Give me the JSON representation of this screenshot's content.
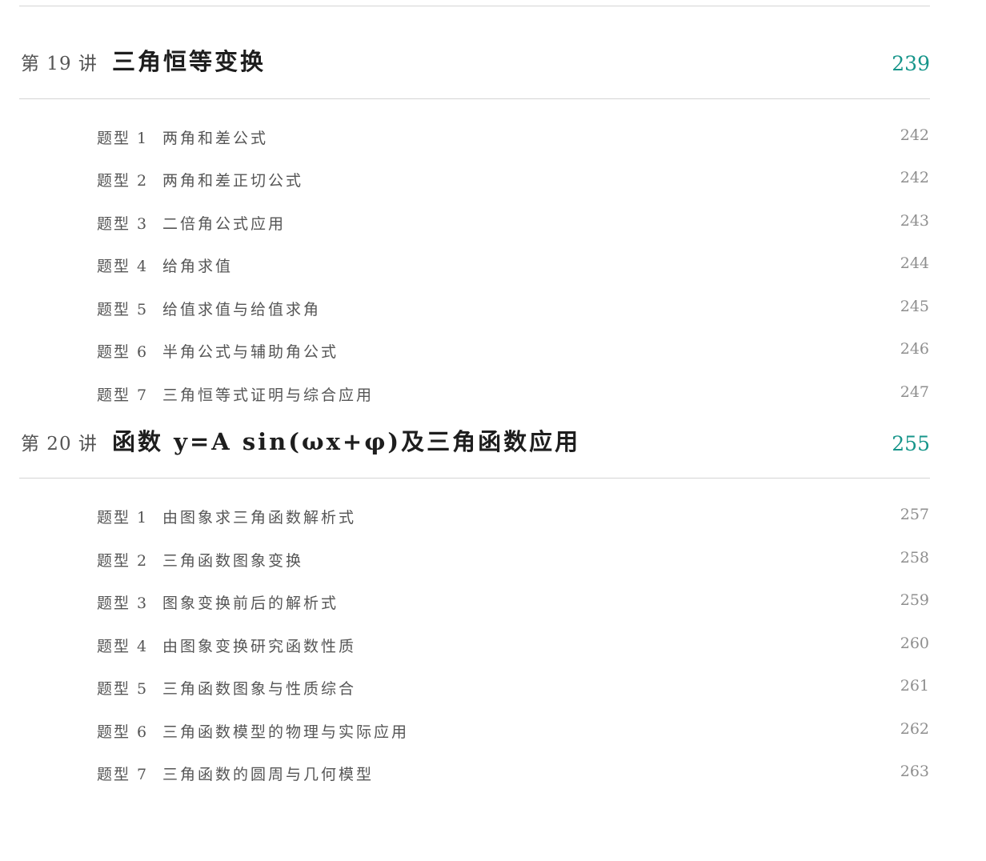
{
  "chapters": [
    {
      "prefix": "第 19 讲",
      "title": "三角恒等变换",
      "page": "239",
      "items": [
        {
          "prefix": "题型 1",
          "title": "两角和差公式",
          "page": "242"
        },
        {
          "prefix": "题型 2",
          "title": "两角和差正切公式",
          "page": "242"
        },
        {
          "prefix": "题型 3",
          "title": "二倍角公式应用",
          "page": "243"
        },
        {
          "prefix": "题型 4",
          "title": "给角求值",
          "page": "244"
        },
        {
          "prefix": "题型 5",
          "title": "给值求值与给值求角",
          "page": "245"
        },
        {
          "prefix": "题型 6",
          "title": "半角公式与辅助角公式",
          "page": "246"
        },
        {
          "prefix": "题型 7",
          "title": "三角恒等式证明与综合应用",
          "page": "247"
        }
      ]
    },
    {
      "prefix": "第 20 讲",
      "title": "函数 y=A sin(ωx+φ)及三角函数应用",
      "page": "255",
      "items": [
        {
          "prefix": "题型 1",
          "title": "由图象求三角函数解析式",
          "page": "257"
        },
        {
          "prefix": "题型 2",
          "title": "三角函数图象变换",
          "page": "258"
        },
        {
          "prefix": "题型 3",
          "title": "图象变换前后的解析式",
          "page": "259"
        },
        {
          "prefix": "题型 4",
          "title": "由图象变换研究函数性质",
          "page": "260"
        },
        {
          "prefix": "题型 5",
          "title": "三角函数图象与性质综合",
          "page": "261"
        },
        {
          "prefix": "题型 6",
          "title": "三角函数模型的物理与实际应用",
          "page": "262"
        },
        {
          "prefix": "题型 7",
          "title": "三角函数的圆周与几何模型",
          "page": "263"
        }
      ]
    }
  ],
  "colors": {
    "page_accent": "#16958a",
    "rule": "#d4d4d4"
  }
}
